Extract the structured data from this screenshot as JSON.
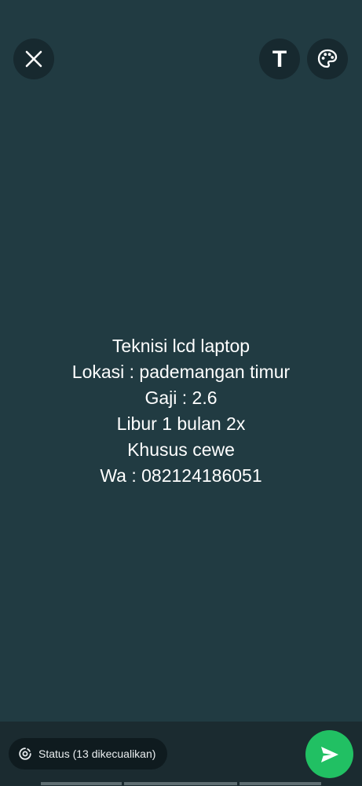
{
  "toolbar": {
    "close_icon": "close-icon",
    "text_tool_label": "T",
    "palette_icon": "palette-icon"
  },
  "status": {
    "lines": [
      "Teknisi lcd laptop",
      "Lokasi : pademangan timur",
      "Gaji : 2.6",
      "Libur 1 bulan 2x",
      "Khusus cewe",
      "Wa : 082124186051"
    ],
    "background_color": "#213b42",
    "text_color": "#ffffff"
  },
  "footer": {
    "audience_label": "Status (13 dikecualikan)",
    "audience_icon": "status-privacy-icon",
    "send_icon": "send-icon",
    "send_color": "#21c063"
  }
}
